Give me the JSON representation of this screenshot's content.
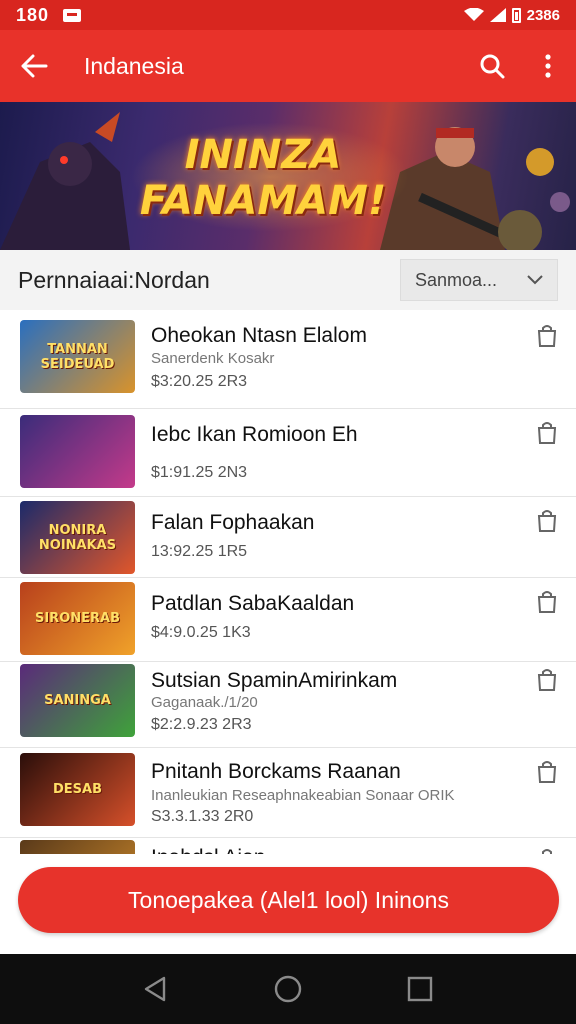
{
  "status_bar": {
    "time": "180",
    "battery_text": "2386"
  },
  "app_bar": {
    "title": "Indanesia",
    "back_icon": "arrow-left-icon",
    "search_icon": "search-icon",
    "more_icon": "more-vert-icon"
  },
  "banner": {
    "title_line1": "ININZA",
    "title_line2": "FANAMAM!"
  },
  "section": {
    "title": "Pernnaiaai:Nordan",
    "sort_value": "Sanmoa..."
  },
  "games": [
    {
      "name": "Oheokan Ntasn Elalom",
      "subtitle": "Sanerdenk Kosakr",
      "meta": "$3:20.25 2R3",
      "thumb_text": "TANNAN SEIDEUAD",
      "colors": [
        "#2a6fbf",
        "#d9932b"
      ]
    },
    {
      "name": "Iebc Ikan Romioon Eh",
      "subtitle": "",
      "meta": "$1:91.25 2N3",
      "thumb_text": "",
      "colors": [
        "#3a2c7a",
        "#c43a8a"
      ]
    },
    {
      "name": "Falan Fophaakan",
      "subtitle": "",
      "meta": "13:92.25 1R5",
      "thumb_text": "NONIRA NOINAKAS",
      "colors": [
        "#1b2a6a",
        "#e2572a"
      ]
    },
    {
      "name": "Patdlan SabaKaaldan",
      "subtitle": "",
      "meta": "$4:9.0.25 1K3",
      "thumb_text": "SIRONERAB",
      "colors": [
        "#b8401c",
        "#f0a22a"
      ]
    },
    {
      "name": "Sutsian SpaminAmirinkam",
      "subtitle": "Gaganaak./1/20",
      "meta": "$2:2.9.23 2R3",
      "thumb_text": "SANINGA",
      "colors": [
        "#5a2a7a",
        "#3fa33a"
      ]
    },
    {
      "name": "Pnitanh Borckams Raanan",
      "subtitle": "Inanleukian Reseaphnakeabian Sonaar ORIK",
      "meta": "S3.3.1.33 2R0",
      "thumb_text": "DESAB",
      "colors": [
        "#2a0e0a",
        "#d6502a"
      ]
    },
    {
      "name": "Inabdsl Aian",
      "subtitle": "",
      "meta": "",
      "thumb_text": "",
      "colors": [
        "#5a3a1a",
        "#c8862a"
      ]
    }
  ],
  "cta": {
    "label": "Tonoepakea (Alel1 lool) Ininons"
  },
  "nav": {
    "back_icon": "triangle-back-icon",
    "home_icon": "circle-home-icon",
    "recents_icon": "square-recents-icon"
  }
}
